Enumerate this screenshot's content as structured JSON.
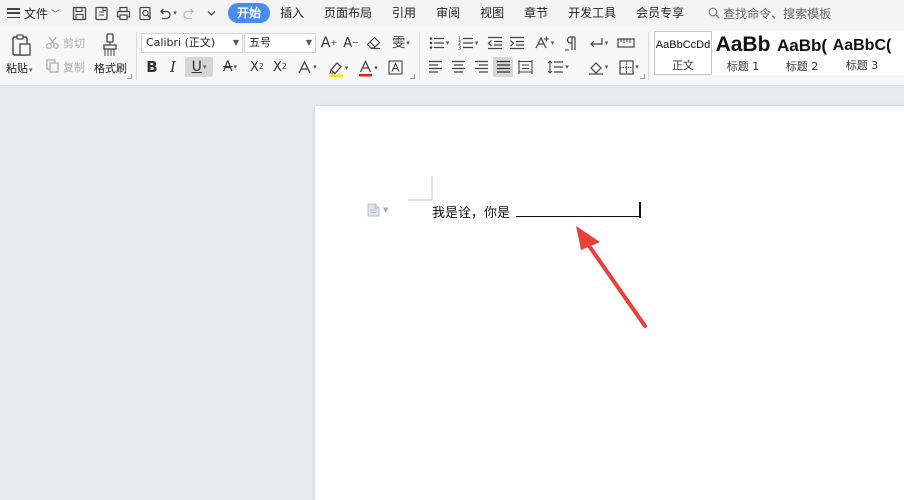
{
  "menubar": {
    "file_label": "文件",
    "tabs": [
      {
        "label": "开始",
        "active": true
      },
      {
        "label": "插入"
      },
      {
        "label": "页面布局"
      },
      {
        "label": "引用"
      },
      {
        "label": "审阅"
      },
      {
        "label": "视图"
      },
      {
        "label": "章节"
      },
      {
        "label": "开发工具"
      },
      {
        "label": "会员专享"
      }
    ],
    "search_placeholder": "查找命令、搜索模板"
  },
  "ribbon": {
    "clipboard": {
      "paste": "粘贴",
      "cut": "剪切",
      "copy": "复制",
      "format_painter": "格式刷"
    },
    "font": {
      "font_name": "Calibri (正文)",
      "font_size": "五号",
      "phonetic_guide": "雯"
    },
    "styles": [
      {
        "sample": "AaBbCcDd",
        "name": "正文"
      },
      {
        "sample": "AaBb",
        "name": "标题 1"
      },
      {
        "sample": "AaBb(",
        "name": "标题 2"
      },
      {
        "sample": "AaBbC(",
        "name": "标题 3"
      }
    ]
  },
  "document": {
    "text": "我是诠，你是"
  },
  "colors": {
    "accent": "#4a8bf0",
    "arrow": "#e8413b",
    "highlight_yellow": "#f5e400",
    "font_color_red": "#e02020"
  }
}
